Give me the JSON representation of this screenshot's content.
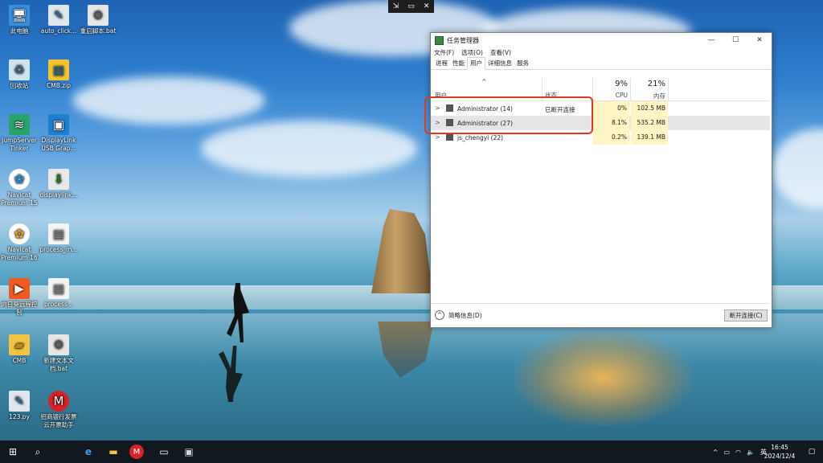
{
  "remote_bar": {
    "pin": "⇲",
    "screen": "▭",
    "close": "✕"
  },
  "desktop_icons": [
    {
      "label": "此电脑",
      "icon": "computer-icon"
    },
    {
      "label": "auto_click...",
      "icon": "python-file-icon"
    },
    {
      "label": "重启脚本.bat",
      "icon": "batch-file-icon"
    },
    {
      "label": "回收站",
      "icon": "recycle-bin-icon"
    },
    {
      "label": "CMB.zip",
      "icon": "zip-icon"
    },
    {
      "label": "JumpServer Tinker",
      "icon": "jumpserver-icon"
    },
    {
      "label": "DisplayLink USB Grap...",
      "icon": "displaylink-icon"
    },
    {
      "label": "Navicat Premium 15",
      "icon": "navicat-icon"
    },
    {
      "label": "displaylink...",
      "icon": "installer-icon"
    },
    {
      "label": "Navicat Premium 16",
      "icon": "navicat-icon"
    },
    {
      "label": "process_m...",
      "icon": "text-file-icon"
    },
    {
      "label": "向日葵远程控制",
      "icon": "sunlogin-icon"
    },
    {
      "label": "process...",
      "icon": "text-file-icon"
    },
    {
      "label": "CMB",
      "icon": "folder-icon"
    },
    {
      "label": "新建文本文档.bat",
      "icon": "batch-file-icon"
    },
    {
      "label": "123.py",
      "icon": "python-file-icon"
    },
    {
      "label": "招商银行发票云开票助手",
      "icon": "cmb-icon"
    }
  ],
  "task_manager": {
    "title": "任务管理器",
    "controls": {
      "minimize": "—",
      "maximize": "☐",
      "close": "✕"
    },
    "menu": [
      "文件(F)",
      "选项(O)",
      "查看(V)"
    ],
    "tabs": [
      "进程",
      "性能",
      "用户",
      "详细信息",
      "服务"
    ],
    "active_tab": "用户",
    "columns": {
      "user": "用户",
      "status": "状态",
      "cpu_pct": "9%",
      "cpu": "CPU",
      "mem_pct": "21%",
      "mem": "内存",
      "sort_arrow": "^"
    },
    "rows": [
      {
        "expand": ">",
        "name": "Administrator (14)",
        "status": "已断开连接",
        "cpu": "0%",
        "mem": "102.5 MB"
      },
      {
        "expand": ">",
        "name": "Administrator (27)",
        "status": "",
        "cpu": "8.1%",
        "mem": "535.2 MB"
      },
      {
        "expand": ">",
        "name": "js_chengyi (22)",
        "status": "",
        "cpu": "0.2%",
        "mem": "139.1 MB"
      }
    ],
    "fewer_details": "简略信息(D)",
    "fewer_details_icon": "^",
    "disconnect_button": "断开连接(C)"
  },
  "taskbar": {
    "start": "⊞",
    "search": "⌕",
    "ie": "e",
    "explorer": "▬",
    "cmb": "M",
    "terminal": "▭",
    "rdp": "▣",
    "tray": {
      "chevron": "^",
      "ime": "英",
      "time": "16:45",
      "date": "2024/12/4",
      "notify": "▢"
    }
  },
  "colors": {
    "highlight_box": "#e0391f",
    "cell_highlight": "#fff4c4",
    "taskbar": "#121820"
  }
}
